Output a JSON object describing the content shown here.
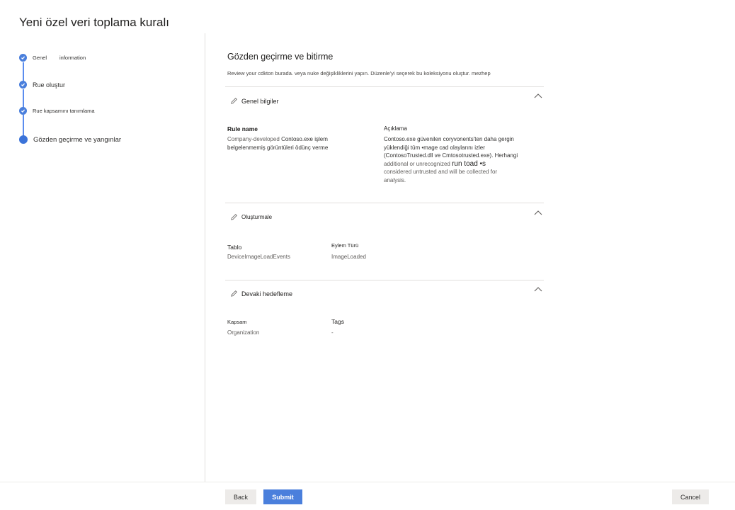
{
  "window": {
    "title": "Yeni özel veri toplama kuralı"
  },
  "wizard": {
    "steps": [
      {
        "label_a": "Genel",
        "label_b": "information",
        "state": "done"
      },
      {
        "label": "Rue oluştur",
        "state": "done"
      },
      {
        "label": "Rue kapsamını tanımlama",
        "state": "done"
      },
      {
        "label": "Gözden geçirme ve yangınlar",
        "state": "current"
      }
    ]
  },
  "main": {
    "heading": "Gözden geçirme ve bitirme",
    "intro": "Review your cdkton burada. veya nuke değişikliklerini yapın. Düzenle'yi seçerek bu koleksiyonu oluştur.  mezhep",
    "sections": {
      "general": {
        "title": "Genel bilgiler",
        "rule_name_label": "Rule name",
        "rule_name_value_a": "Company-developed",
        "rule_name_value_b": "Contoso.exe işlem",
        "rule_name_value_c": "belgelenmemiş görüntüleri ödünç verme",
        "description_label": "Açıklama",
        "description_line1": "Contoso.exe güvenilen coryvonents'ten daha gergin",
        "description_line2": "yüklendiği tüm •mage cad olaylarını izler",
        "description_line3": "(ContosoTrusted.dll ve Cmtosotrusted.exe). Herhangi",
        "description_line4a": "additional or unrecognized",
        "description_line4b": "run toad •s",
        "description_line5": "considered untrusted and will be collected for",
        "description_line6": "analysis."
      },
      "create": {
        "title": "Oluşturmale",
        "table_label": "Tablo",
        "table_value": "DeviceImageLoadEvents",
        "action_label": "Eylem Türü",
        "action_value": "ImageLoaded"
      },
      "scope": {
        "title": "Devaki hedefleme",
        "scope_label": "Kapsam",
        "scope_value": "Organization",
        "tags_label": "Tags",
        "tags_value": "-"
      }
    }
  },
  "footer": {
    "back_label": "Back",
    "submit_label": "Submit",
    "cancel_label": "Cancel"
  },
  "colors": {
    "accent": "#4a7fdc",
    "divider": "#e1dfdd",
    "secondary_button": "#edebe9"
  },
  "icons": [
    "check-icon",
    "pencil-icon",
    "chevron-up-icon"
  ]
}
